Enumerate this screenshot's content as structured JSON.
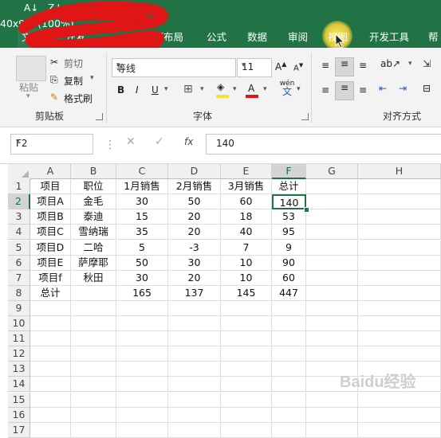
{
  "window": {
    "dimension_readout": "40x920(100%)",
    "tabs": [
      "文件",
      "开发",
      "页面布局",
      "公式",
      "数据",
      "审阅",
      "视图",
      "开发工具",
      "帮"
    ]
  },
  "ribbon": {
    "clipboard": {
      "paste": "粘贴",
      "cut": "剪切",
      "copy": "复制",
      "format_painter": "格式刷",
      "group": "剪贴板"
    },
    "font": {
      "name": "等线",
      "size": "11",
      "bold": "B",
      "italic": "I",
      "underline": "U",
      "group": "字体"
    },
    "alignment": {
      "group": "对齐方式"
    },
    "wen": "wén"
  },
  "formula_bar": {
    "name_box": "F2",
    "fx": "fx",
    "value": "140"
  },
  "grid": {
    "columns": [
      "A",
      "B",
      "C",
      "D",
      "E",
      "F",
      "G",
      "H"
    ],
    "rows": [
      "1",
      "2",
      "3",
      "4",
      "5",
      "6",
      "7",
      "8",
      "9",
      "10",
      "11",
      "12",
      "13",
      "14",
      "15",
      "16",
      "17"
    ],
    "cells": [
      [
        "项目",
        "职位",
        "1月销售",
        "2月销售",
        "3月销售",
        "总计"
      ],
      [
        "项目A",
        "金毛",
        "30",
        "50",
        "60",
        "140"
      ],
      [
        "项目B",
        "泰迪",
        "15",
        "20",
        "18",
        "53"
      ],
      [
        "项目C",
        "雪纳瑞",
        "35",
        "20",
        "40",
        "95"
      ],
      [
        "项目D",
        "二哈",
        "5",
        "-3",
        "7",
        "9"
      ],
      [
        "项目E",
        "萨摩耶",
        "50",
        "30",
        "10",
        "90"
      ],
      [
        "项目f",
        "秋田",
        "30",
        "20",
        "10",
        "60"
      ],
      [
        "总计",
        "",
        "165",
        "137",
        "145",
        "447"
      ]
    ],
    "active_cell": "F2",
    "accent": "#217346"
  },
  "watermark": "Baidu经验"
}
